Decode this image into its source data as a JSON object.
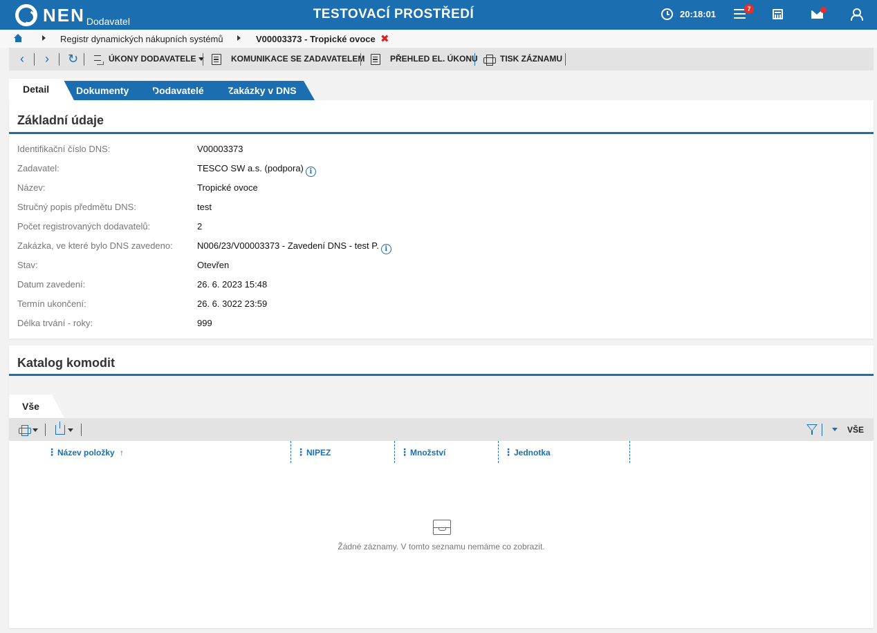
{
  "header": {
    "logo": "NEN",
    "logo_sub": "Dodavatel",
    "env_title": "TESTOVACÍ PROSTŘEDÍ",
    "time": "20:18:01",
    "menu_badge": "7",
    "colors": {
      "primary": "#1b6eaf",
      "badge": "#e53030"
    },
    "icons": [
      "clock-icon",
      "menu-icon",
      "calculator-icon",
      "mail-icon",
      "user-icon"
    ]
  },
  "breadcrumb": {
    "items": [
      "Registr dynamických nákupních systémů",
      "V00003373 - Tropické ovoce"
    ],
    "close": "✖"
  },
  "toolbar": {
    "prev": "‹",
    "next": "›",
    "refresh": "↻",
    "ukony": "ÚKONY DODAVATELE",
    "komunikace": "KOMUNIKACE SE ZADAVATELEM",
    "prehled": "PŘEHLED EL. ÚKONU",
    "tisk": "TISK ZÁZNAMU"
  },
  "tabs": [
    "Detail",
    "Dokumenty",
    "Dodavatelé",
    "Zakázky v DNS"
  ],
  "zakladni": {
    "title": "Základní údaje",
    "fields": [
      {
        "label": "Identifikační číslo DNS:",
        "value": "V00003373"
      },
      {
        "label": "Zadavatel:",
        "value": "TESCO SW a.s. (podpora)"
      },
      {
        "label": "Název:",
        "value": "Tropické ovoce"
      },
      {
        "label": "Stručný popis předmětu DNS:",
        "value": "test"
      },
      {
        "label": "Počet registrovaných dodavatelů:",
        "value": "2"
      },
      {
        "label": "Zakázka, ve které bylo DNS zavedeno:",
        "value": "N006/23/V00003373 - Zavedení DNS - test P."
      },
      {
        "label": "Stav:",
        "value": "Otevřen"
      },
      {
        "label": "Datum zavedení:",
        "value": "26. 6. 2023 15:48"
      },
      {
        "label": "Termín ukončení:",
        "value": "26. 6. 3022 23:59"
      },
      {
        "label": "Délka trvání - roky:",
        "value": "999"
      }
    ],
    "info": "i"
  },
  "katalog": {
    "title": "Katalog komodit",
    "subtab": "Vše",
    "all": "VŠE",
    "columns": [
      {
        "label": "Název položky",
        "sort": "↑"
      },
      {
        "label": "NIPEZ"
      },
      {
        "label": "Množství"
      },
      {
        "label": "Jednotka"
      }
    ],
    "empty": "Žádné záznamy. V tomto seznamu nemáme co zobrazit."
  }
}
